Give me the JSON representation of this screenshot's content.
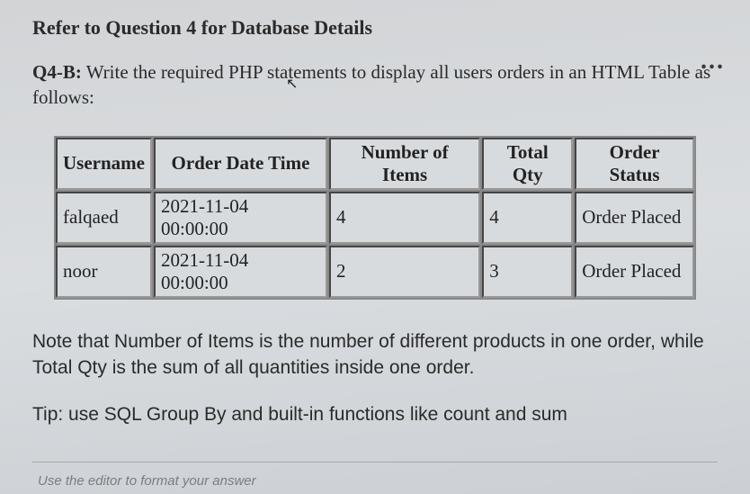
{
  "title": "Refer to Question 4 for Database Details",
  "ellipsis": "...",
  "question": {
    "label": "Q4-B:",
    "text": " Write the required PHP statements to display all users orders in an HTML Table as follows:"
  },
  "chart_data": {
    "type": "table",
    "headers": [
      "Username",
      "Order Date Time",
      "Number of Items",
      "Total Qty",
      "Order Status"
    ],
    "rows": [
      [
        "falqaed",
        "2021-11-04 00:00:00",
        "4",
        "4",
        "Order Placed"
      ],
      [
        "noor",
        "2021-11-04 00:00:00",
        "2",
        "3",
        "Order Placed"
      ]
    ]
  },
  "note": "Note that Number of Items is the number of different products in one order, while Total Qty is the sum of all quantities inside one order.",
  "tip": "Tip: use SQL Group By and built-in functions like count and sum",
  "editor_hint": "Use the editor to format your answer"
}
